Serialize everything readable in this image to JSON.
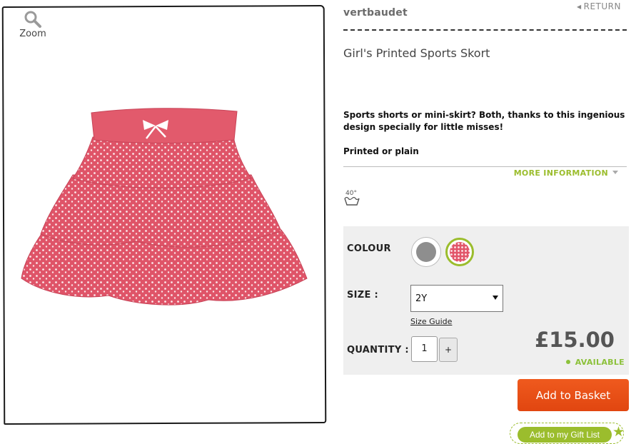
{
  "brand": "vertbaudet",
  "nav": {
    "return_label": "RETURN"
  },
  "image_panel": {
    "zoom_label": "Zoom",
    "zoom_icon": "magnifier-icon"
  },
  "product": {
    "title": "Girl's Printed Sports Skort",
    "description": "Sports shorts or mini-skirt? Both, thanks to this ingenious design specially for little misses!",
    "variant_note": "Printed or plain",
    "more_info_label": "MORE INFORMATION",
    "care": {
      "wash_temp": "40°",
      "icon": "wash-icon"
    },
    "price": "£15.00",
    "availability": "AVAILABLE"
  },
  "options": {
    "colour_label": "COLOUR",
    "colours": [
      {
        "name": "grey",
        "hex": "#8e8e8e"
      },
      {
        "name": "pink-print",
        "hex": "#e2566a",
        "selected": true
      }
    ],
    "size_label": "SIZE :",
    "size_value": "2Y",
    "size_guide_label": "Size Guide",
    "quantity_label": "QUANTITY :",
    "quantity_value": "1",
    "plus_label": "+"
  },
  "actions": {
    "add_to_basket": "Add to Basket",
    "gift_list": "Add to my Gift List"
  },
  "colors": {
    "accent_green": "#9bbd2d",
    "cta_orange": "#e8501a",
    "price_grey": "#555555"
  }
}
